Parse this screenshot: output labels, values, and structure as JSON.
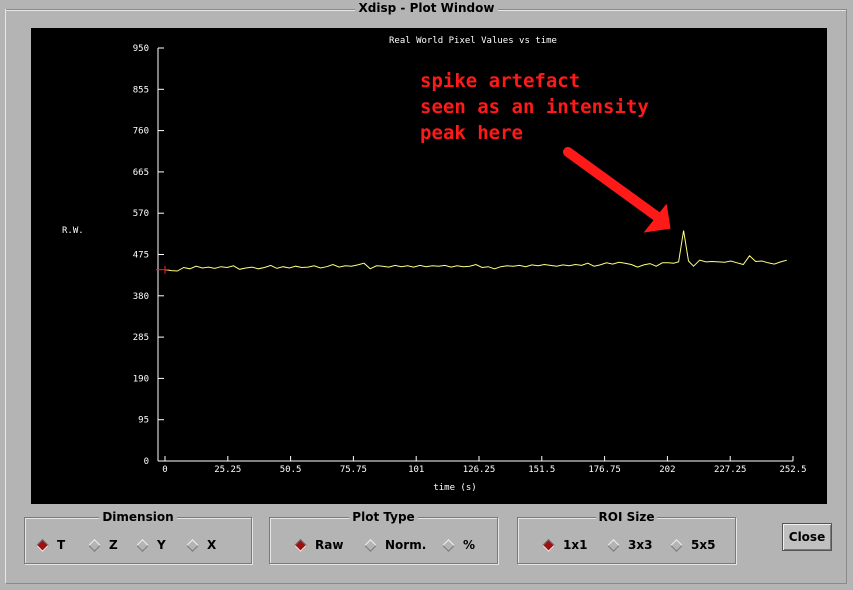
{
  "window": {
    "title": "Xdisp - Plot Window"
  },
  "chart_data": {
    "type": "line",
    "title": "Real World Pixel Values vs time",
    "xlabel": "time (s)",
    "ylabel": "R.W.",
    "xlim": [
      0,
      252.5
    ],
    "ylim": [
      0,
      950
    ],
    "x_ticks": [
      "0",
      "25.25",
      "50.5",
      "75.75",
      "101",
      "126.25",
      "151.5",
      "176.75",
      "202",
      "227.25",
      "252.5"
    ],
    "y_ticks": [
      "0",
      "95",
      "190",
      "285",
      "380",
      "475",
      "570",
      "665",
      "760",
      "855",
      "950"
    ],
    "series_color": "#ffff80",
    "marker_color": "#ff2020",
    "x": [
      0,
      2.5,
      5,
      7.5,
      10,
      12.5,
      15,
      17.5,
      20,
      22.5,
      25,
      27.5,
      30,
      32.5,
      35,
      37.5,
      40,
      42.5,
      45,
      47.5,
      50,
      52.5,
      55,
      57.5,
      60,
      62.5,
      65,
      67.5,
      70,
      72.5,
      75,
      77.5,
      80,
      82.5,
      85,
      87.5,
      90,
      92.5,
      95,
      97.5,
      100,
      102.5,
      105,
      107.5,
      110,
      112.5,
      115,
      117.5,
      120,
      122.5,
      125,
      127.5,
      130,
      132.5,
      135,
      137.5,
      140,
      142.5,
      145,
      147.5,
      150,
      152.5,
      155,
      157.5,
      160,
      162.5,
      165,
      167.5,
      170,
      172.5,
      175,
      177.5,
      180,
      182.5,
      185,
      187.5,
      190,
      192.5,
      195,
      197.5,
      200,
      202.5,
      204.5,
      206.5,
      208.5,
      210.5,
      212.5,
      215,
      217.5,
      220,
      222.5,
      225,
      227.5,
      230,
      232.5,
      235,
      237.5,
      240,
      242.5,
      245,
      247.5,
      250
    ],
    "values": [
      440,
      438,
      437,
      445,
      442,
      448,
      444,
      446,
      443,
      447,
      445,
      449,
      441,
      444,
      446,
      442,
      445,
      450,
      443,
      447,
      444,
      448,
      445,
      446,
      449,
      444,
      447,
      452,
      446,
      449,
      448,
      451,
      455,
      442,
      449,
      448,
      446,
      450,
      447,
      449,
      446,
      450,
      447,
      449,
      448,
      450,
      446,
      449,
      447,
      448,
      452,
      445,
      447,
      442,
      447,
      449,
      448,
      450,
      447,
      451,
      449,
      452,
      450,
      448,
      451,
      449,
      452,
      450,
      455,
      448,
      451,
      456,
      453,
      457,
      455,
      452,
      446,
      451,
      454,
      448,
      456,
      456,
      455,
      458,
      530,
      460,
      448,
      462,
      458,
      459,
      458,
      457,
      460,
      456,
      452,
      472,
      459,
      460,
      456,
      453,
      458,
      462
    ],
    "annotation": {
      "text_lines": [
        "spike artefact",
        "seen as an intensity",
        "peak here"
      ],
      "color": "#ff1a1a",
      "points_to": {
        "x": 206.5,
        "y": 530
      }
    }
  },
  "controls": {
    "dimension": {
      "label": "Dimension",
      "options": [
        {
          "label": "T",
          "selected": true
        },
        {
          "label": "Z",
          "selected": false
        },
        {
          "label": "Y",
          "selected": false
        },
        {
          "label": "X",
          "selected": false
        }
      ]
    },
    "plot_type": {
      "label": "Plot Type",
      "options": [
        {
          "label": "Raw",
          "selected": true
        },
        {
          "label": "Norm.",
          "selected": false
        },
        {
          "label": "%",
          "selected": false
        }
      ]
    },
    "roi_size": {
      "label": "ROI Size",
      "options": [
        {
          "label": "1x1",
          "selected": true
        },
        {
          "label": "3x3",
          "selected": false
        },
        {
          "label": "5x5",
          "selected": false
        }
      ]
    },
    "close_label": "Close"
  }
}
